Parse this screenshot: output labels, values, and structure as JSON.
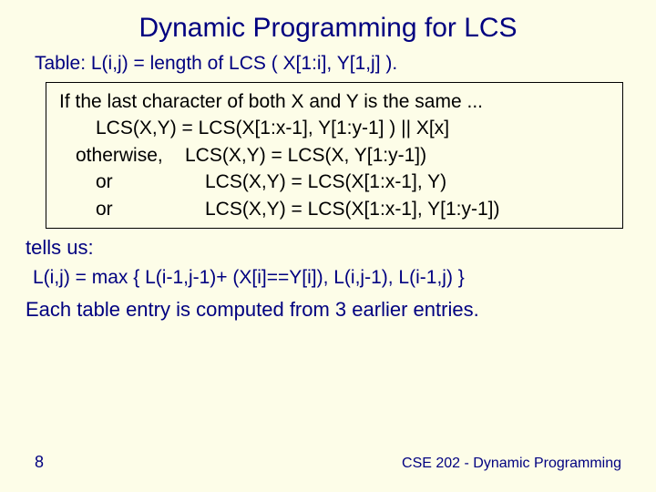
{
  "title": "Dynamic Programming for LCS",
  "subhead": "Table: L(i,j) = length of LCS ( X[1:i], Y[1,j] ).",
  "box": {
    "line1": "If the last character of both X and Y is the same ...",
    "line2": "LCS(X,Y) =  LCS(X[1:x-1], Y[1:y-1] ) || X[x]",
    "otherwise_label": "otherwise,",
    "otherwise_value": "LCS(X,Y) = LCS(X, Y[1:y-1])",
    "or1_label": "or",
    "or1_value": "LCS(X,Y) = LCS(X[1:x-1], Y)",
    "or2_label": "or",
    "or2_value": "LCS(X,Y) = LCS(X[1:x-1], Y[1:y-1])"
  },
  "tells": "tells us:",
  "formula": "L(i,j) = max { L(i-1,j-1)+ (X[i]==Y[i]), L(i,j-1), L(i-1,j) }",
  "conclusion": "Each table entry is computed from 3 earlier entries.",
  "pagenum": "8",
  "footer": "CSE 202 - Dynamic Programming"
}
